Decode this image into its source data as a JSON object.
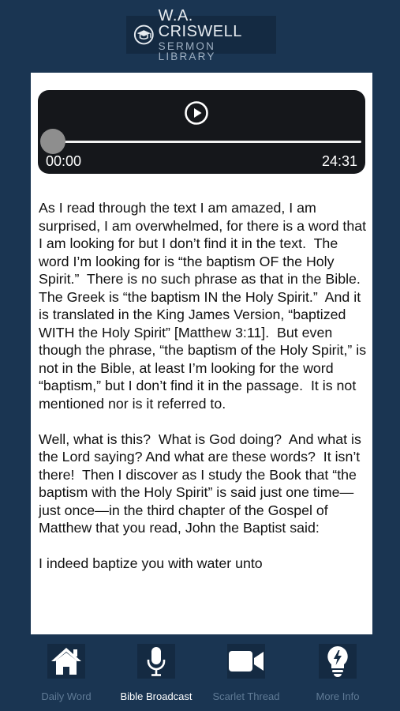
{
  "header": {
    "logo_line1": "W.A. CRISWELL",
    "logo_line2": "SERMON LIBRARY"
  },
  "player": {
    "current_time": "00:00",
    "total_time": "24:31",
    "progress": 0
  },
  "sermon": {
    "paragraphs": [
      "As I read through the text I am amazed, I am surprised, I am overwhelmed, for there is a word that I am looking for but I don’t find it in the text.  The word I’m looking for is “the baptism OF the Holy Spirit.”  There is no such phrase as that in the Bible.  The Greek is “the baptism IN the Holy Spirit.”  And it is translated in the King James Version, “baptized WITH the Holy Spirit” [Matthew 3:11].  But even though the phrase, “the baptism of the Holy Spirit,” is not in the Bible, at least I’m looking for the word “baptism,” but I don’t find it in the passage.  It is not mentioned nor is it referred to.",
      "Well, what is this?  What is God doing?  And what is the Lord saying? And what are these words?  It isn’t there!  Then I discover as I study the Book that “the baptism with the Holy Spirit” is said just one time—just once—in the third chapter of the Gospel of Matthew that you read, John the Baptist said:",
      "I indeed baptize you with water unto"
    ]
  },
  "tabs": [
    {
      "label": "Daily Word",
      "icon": "home-icon",
      "active": false
    },
    {
      "label": "Bible Broadcast",
      "icon": "microphone-icon",
      "active": true
    },
    {
      "label": "Scarlet Thread",
      "icon": "video-camera-icon",
      "active": false
    },
    {
      "label": "More Info",
      "icon": "lightbulb-icon",
      "active": false
    }
  ]
}
